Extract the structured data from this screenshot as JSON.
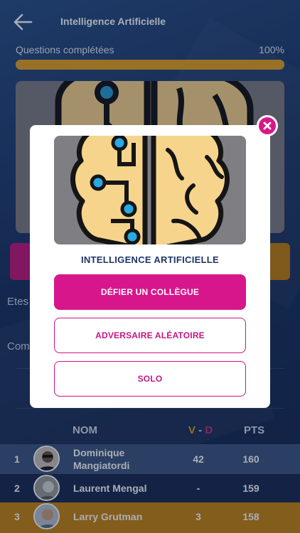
{
  "header": {
    "title": "Intelligence Artificielle",
    "back_icon": "arrow-left-icon"
  },
  "progress": {
    "label": "Questions complétées",
    "value_text": "100%",
    "fraction": 1.0,
    "color": "#e6a322"
  },
  "background": {
    "text1": "Etes",
    "text2": "Com"
  },
  "leaderboard": {
    "columns": {
      "nom": "NOM",
      "v": "V",
      "sep": " - ",
      "d": "D",
      "pts": "PTS"
    },
    "rows": [
      {
        "rank": "1",
        "name": "Dominique Mangiatordi",
        "vd": "42",
        "pts": "160"
      },
      {
        "rank": "2",
        "name": "Laurent Mengal",
        "vd": "-",
        "pts": "159"
      },
      {
        "rank": "3",
        "name": "Larry Grutman",
        "vd": "3",
        "pts": "158"
      }
    ]
  },
  "modal": {
    "title": "INTELLIGENCE ARTIFICIELLE",
    "image_icon": "brain-circuit-icon",
    "buttons": {
      "challenge": "DÉFIER UN COLLÈGUE",
      "random": "ADVERSAIRE ALÉATOIRE",
      "solo": "SOLO"
    },
    "close_icon": "close-icon"
  },
  "colors": {
    "accent": "#d8168b",
    "gold": "#e6a322",
    "navy": "#1d3665"
  }
}
